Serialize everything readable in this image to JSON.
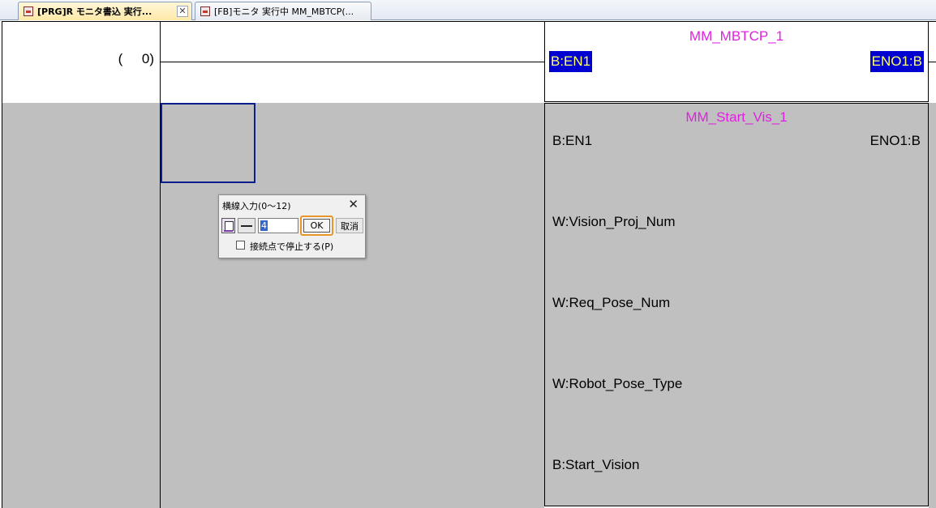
{
  "tabs": [
    {
      "label": "[PRG]R モニタ書込 実行...",
      "active": true,
      "close": "✕"
    },
    {
      "label": "[FB]モニタ 実行中 MM_MBTCP(...",
      "active": false
    }
  ],
  "ladder": {
    "step_label": "(     0)",
    "block1": {
      "title": "MM_MBTCP_1",
      "input": "B:EN1",
      "output": "ENO1:B"
    },
    "block2": {
      "title": "MM_Start_Vis_1",
      "input": "B:EN1",
      "output": "ENO1:B",
      "pins": [
        "W:Vision_Proj_Num",
        "W:Req_Pose_Num",
        "W:Robot_Pose_Type",
        "B:Start_Vision"
      ]
    }
  },
  "dialog": {
    "title": "横線入力(0～12)",
    "close": "✕",
    "value": "4",
    "ok": "OK",
    "cancel": "取消",
    "checkbox_label": "接続点で停止する(P)",
    "checkbox_checked": false
  },
  "colors": {
    "block_title": "#e020e0",
    "highlight_bg": "#0000d0",
    "highlight_fg": "#ffff66",
    "inactive_area": "#bfbfbf",
    "ok_focus": "#e8952a"
  },
  "icons": {
    "tab_icon": "program-icon",
    "dialog_icon": "ladder-icon",
    "dialog_line": "horizontal-line-icon"
  }
}
